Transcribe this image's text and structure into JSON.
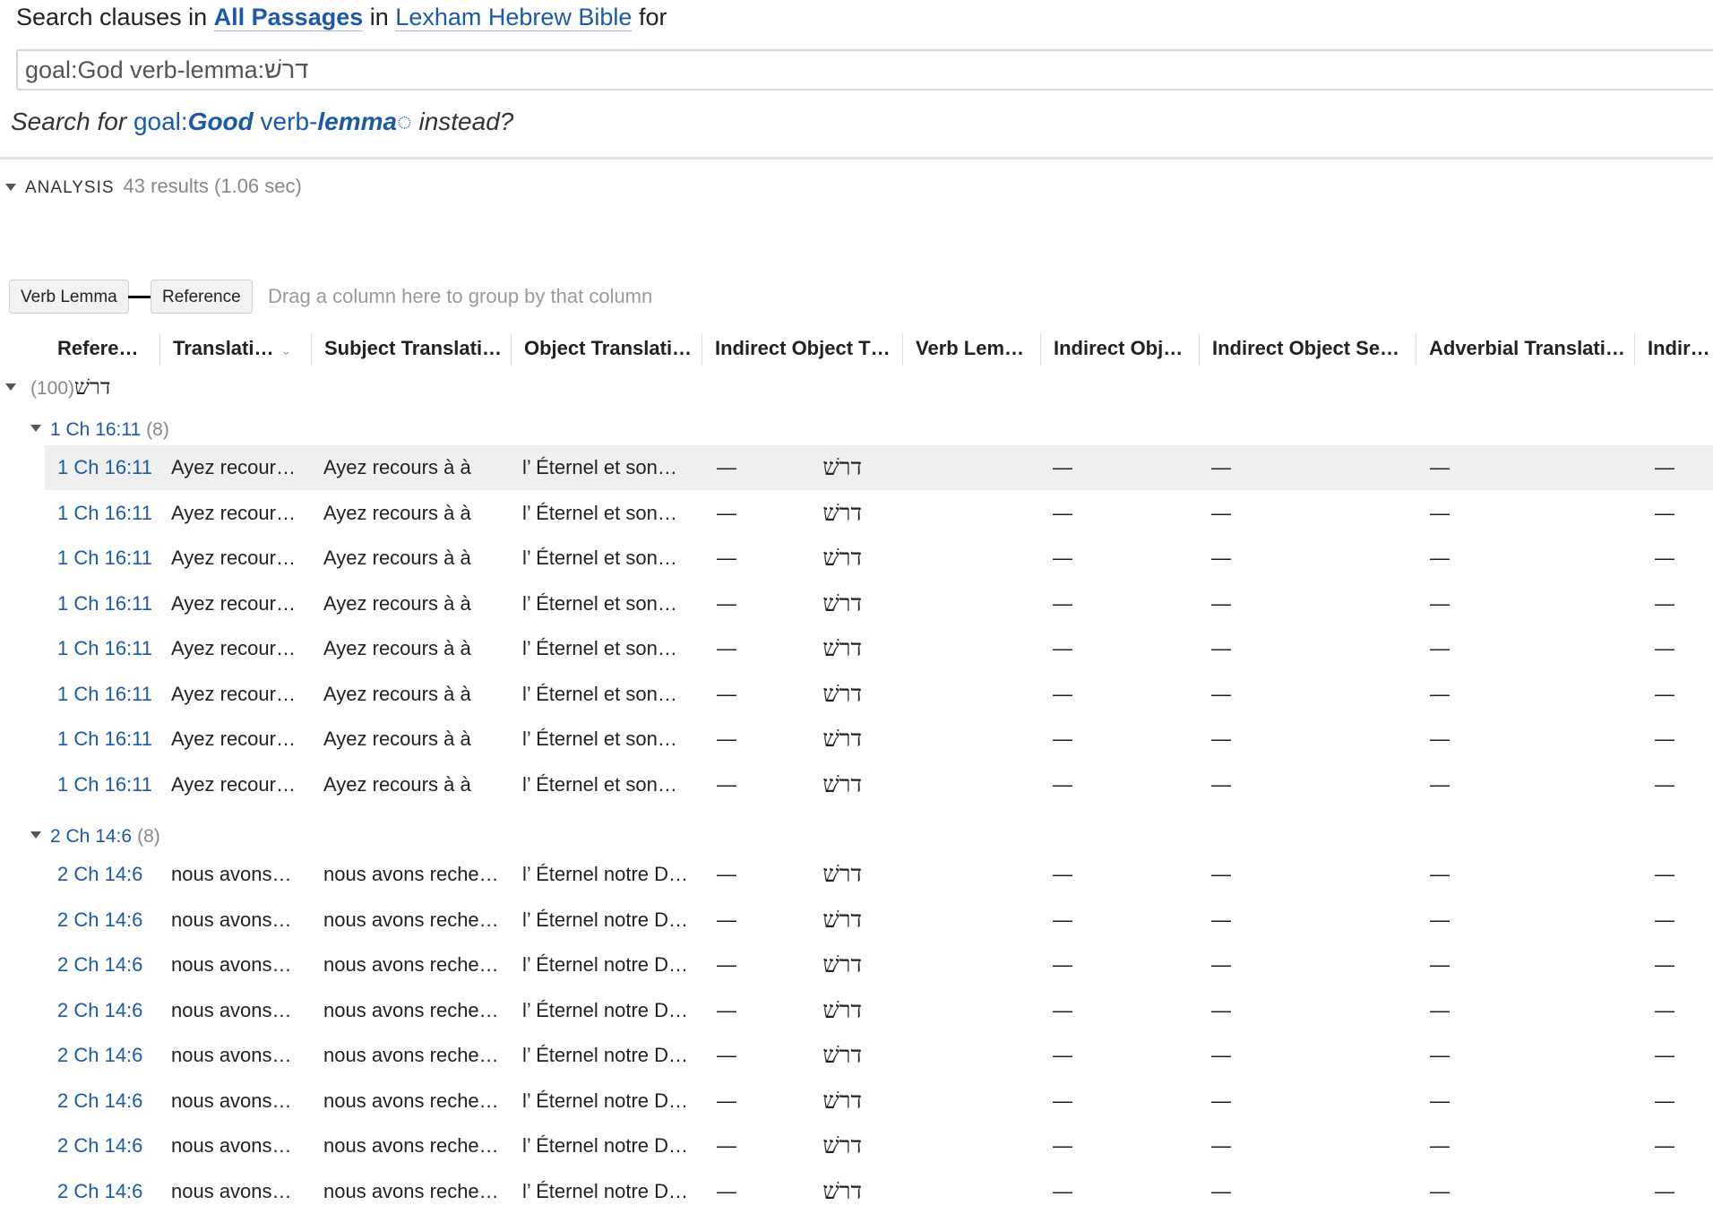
{
  "search": {
    "prefix": "Search clauses in",
    "scope_link": "All Passages",
    "in_word": "in",
    "resource_link": "Lexham Hebrew Bible",
    "for_word": "for",
    "query_value": "goal:God verb-lemma:דרשׁ",
    "suggest_prefix": "Search for",
    "suggest_goal": "goal:",
    "suggest_good": "Good",
    "suggest_verb": " verb-",
    "suggest_lemma": "lemma",
    "suggest_mark": "◌",
    "suggest_suffix": "instead?"
  },
  "analysis": {
    "label": "ANALYSIS",
    "results": "43 results (1.06 sec)"
  },
  "group_panel": {
    "chips": [
      "Verb Lemma",
      "Reference"
    ],
    "hint": "Drag a column here to group by that column"
  },
  "columns": [
    "Refere…",
    "Translati…",
    "Subject Translati…",
    "Object Translati…",
    "Indirect Object T…",
    "Verb Lem…",
    "Indirect Obj…",
    "Indirect Object Se…",
    "Adverbial Translati…",
    "Indirect"
  ],
  "sort_caret": "⌄",
  "top_group": {
    "label": "דרשׁ",
    "count": "(100)"
  },
  "groups": [
    {
      "label": "1 Ch 16:11",
      "count": "(8)",
      "rows": [
        [
          "1 Ch 16:11",
          "Ayez recour…",
          "Ayez recours à à",
          "l’ Éternel et son…",
          "—",
          "דרשׁ",
          "—",
          "—",
          "—",
          "—"
        ],
        [
          "1 Ch 16:11",
          "Ayez recour…",
          "Ayez recours à à",
          "l’ Éternel et son…",
          "—",
          "דרשׁ",
          "—",
          "—",
          "—",
          "—"
        ],
        [
          "1 Ch 16:11",
          "Ayez recour…",
          "Ayez recours à à",
          "l’ Éternel et son…",
          "—",
          "דרשׁ",
          "—",
          "—",
          "—",
          "—"
        ],
        [
          "1 Ch 16:11",
          "Ayez recour…",
          "Ayez recours à à",
          "l’ Éternel et son…",
          "—",
          "דרשׁ",
          "—",
          "—",
          "—",
          "—"
        ],
        [
          "1 Ch 16:11",
          "Ayez recour…",
          "Ayez recours à à",
          "l’ Éternel et son…",
          "—",
          "דרשׁ",
          "—",
          "—",
          "—",
          "—"
        ],
        [
          "1 Ch 16:11",
          "Ayez recour…",
          "Ayez recours à à",
          "l’ Éternel et son…",
          "—",
          "דרשׁ",
          "—",
          "—",
          "—",
          "—"
        ],
        [
          "1 Ch 16:11",
          "Ayez recour…",
          "Ayez recours à à",
          "l’ Éternel et son…",
          "—",
          "דרשׁ",
          "—",
          "—",
          "—",
          "—"
        ],
        [
          "1 Ch 16:11",
          "Ayez recour…",
          "Ayez recours à à",
          "l’ Éternel et son…",
          "—",
          "דרשׁ",
          "—",
          "—",
          "—",
          "—"
        ]
      ]
    },
    {
      "label": "2 Ch 14:6",
      "count": "(8)",
      "rows": [
        [
          "2 Ch 14:6",
          "nous avons…",
          "nous avons reche…",
          "l’ Éternel notre D…",
          "—",
          "דרשׁ",
          "—",
          "—",
          "—",
          "—"
        ],
        [
          "2 Ch 14:6",
          "nous avons…",
          "nous avons reche…",
          "l’ Éternel notre D…",
          "—",
          "דרשׁ",
          "—",
          "—",
          "—",
          "—"
        ],
        [
          "2 Ch 14:6",
          "nous avons…",
          "nous avons reche…",
          "l’ Éternel notre D…",
          "—",
          "דרשׁ",
          "—",
          "—",
          "—",
          "—"
        ],
        [
          "2 Ch 14:6",
          "nous avons…",
          "nous avons reche…",
          "l’ Éternel notre D…",
          "—",
          "דרשׁ",
          "—",
          "—",
          "—",
          "—"
        ],
        [
          "2 Ch 14:6",
          "nous avons…",
          "nous avons reche…",
          "l’ Éternel notre D…",
          "—",
          "דרשׁ",
          "—",
          "—",
          "—",
          "—"
        ],
        [
          "2 Ch 14:6",
          "nous avons…",
          "nous avons reche…",
          "l’ Éternel notre D…",
          "—",
          "דרשׁ",
          "—",
          "—",
          "—",
          "—"
        ],
        [
          "2 Ch 14:6",
          "nous avons…",
          "nous avons reche…",
          "l’ Éternel notre D…",
          "—",
          "דרשׁ",
          "—",
          "—",
          "—",
          "—"
        ],
        [
          "2 Ch 14:6",
          "nous avons…",
          "nous avons reche…",
          "l’ Éternel notre D…",
          "—",
          "דרשׁ",
          "—",
          "—",
          "—",
          "—"
        ]
      ]
    }
  ],
  "colors": {
    "link": "#1b5aa6",
    "selected_row": "#efefef",
    "muted": "#888888"
  }
}
